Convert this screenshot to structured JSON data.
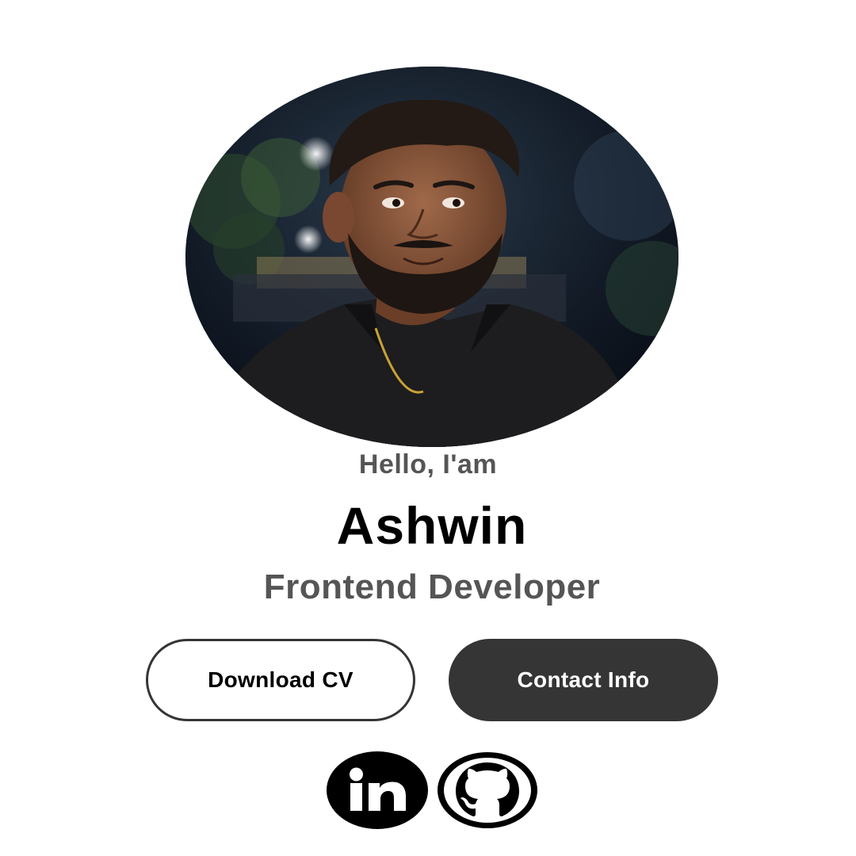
{
  "hero": {
    "greeting": "Hello, I'am",
    "name": "Ashwin",
    "role": "Frontend Developer"
  },
  "actions": {
    "download_cv_label": "Download CV",
    "contact_info_label": "Contact Info"
  },
  "socials": [
    {
      "icon": "linkedin-icon"
    },
    {
      "icon": "github-icon"
    }
  ],
  "colors": {
    "background": "#ffffff",
    "primary_dark": "#353535",
    "secondary_text": "#555555",
    "name_text": "#000000"
  }
}
